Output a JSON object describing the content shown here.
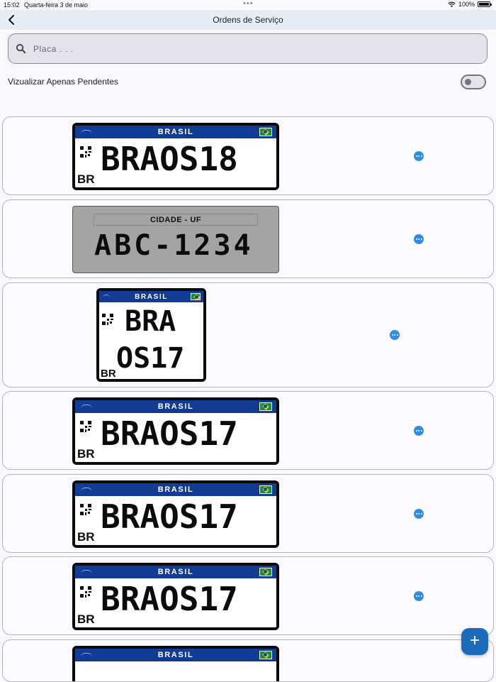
{
  "status_bar": {
    "time": "15:02",
    "date": "Quarta-feira 3 de maio",
    "dots": "•••",
    "battery": "100%"
  },
  "header": {
    "title": "Ordens de Serviço"
  },
  "search": {
    "placeholder": "Placa . . ."
  },
  "filter": {
    "label": "Vizualizar Apenas Pendentes",
    "enabled": false
  },
  "orders": [
    {
      "style": "mercosul",
      "band": "BRASIL",
      "plate": "BRAOS18",
      "country": "BR"
    },
    {
      "style": "antiga",
      "city": "CIDADE - UF",
      "plate": "ABC-1234"
    },
    {
      "style": "mercosul-moto",
      "band": "BRASIL",
      "plate_line1": "BRA",
      "plate_line2": "OS17",
      "country": "BR"
    },
    {
      "style": "mercosul",
      "band": "BRASIL",
      "plate": "BRAOS17",
      "country": "BR"
    },
    {
      "style": "mercosul",
      "band": "BRASIL",
      "plate": "BRAOS17",
      "country": "BR"
    },
    {
      "style": "mercosul",
      "band": "BRASIL",
      "plate": "BRAOS17",
      "country": "BR"
    },
    {
      "style": "mercosul",
      "band": "BRASIL"
    }
  ],
  "fab": {
    "label": "+"
  },
  "colors": {
    "plate_band": "#123b96",
    "action_dot": "#2f8de4",
    "fab": "#1c6bb8",
    "app_bar": "#e6edf7"
  }
}
